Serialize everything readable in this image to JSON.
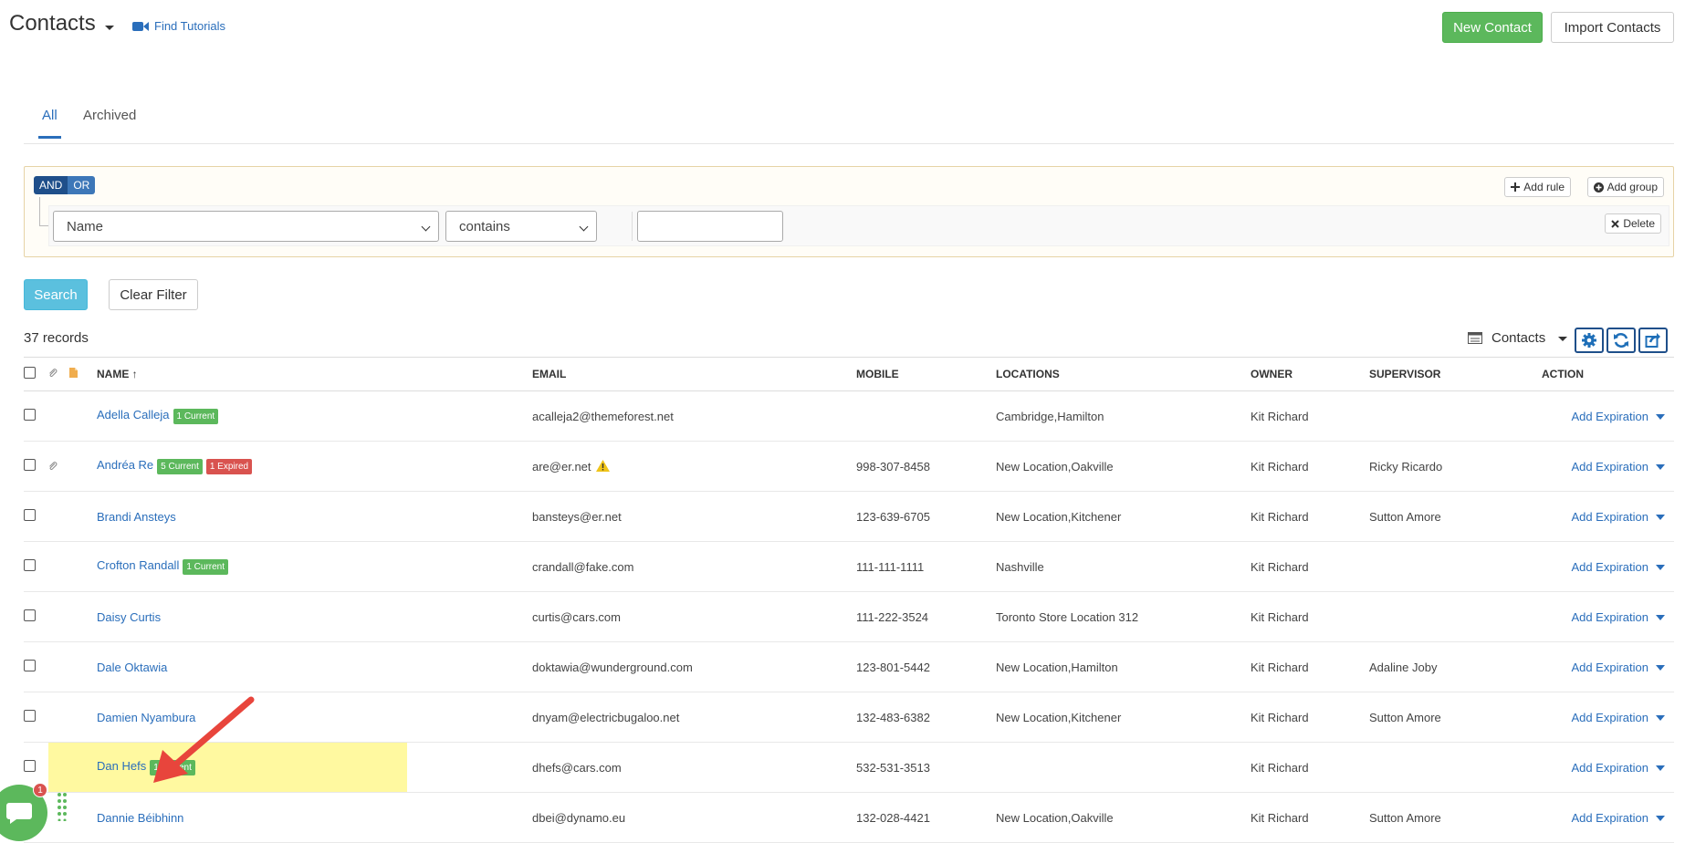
{
  "header": {
    "title": "Contacts",
    "tutorials_label": "Find Tutorials",
    "new_contact_label": "New Contact",
    "import_contacts_label": "Import Contacts"
  },
  "tabs": [
    {
      "label": "All",
      "active": true
    },
    {
      "label": "Archived",
      "active": false
    }
  ],
  "query_builder": {
    "and_label": "AND",
    "or_label": "OR",
    "add_rule_label": "Add rule",
    "add_group_label": "Add group",
    "field_value": "Name",
    "operator_value": "contains",
    "filter_value": "",
    "delete_label": "Delete"
  },
  "actions": {
    "search_label": "Search",
    "clear_filter_label": "Clear Filter"
  },
  "toolbar": {
    "records_label": "37 records",
    "view_label": "Contacts"
  },
  "table": {
    "columns": {
      "name": "NAME ↑",
      "email": "EMAIL",
      "mobile": "MOBILE",
      "locations": "LOCATIONS",
      "owner": "OWNER",
      "supervisor": "SUPERVISOR",
      "action": "ACTION"
    },
    "action_label": "Add Expiration",
    "rows": [
      {
        "name": "Adella Calleja",
        "badge1": "1 Current",
        "email": "acalleja2@themeforest.net",
        "mobile": "",
        "locations": "Cambridge,Hamilton",
        "owner": "Kit Richard",
        "supervisor": ""
      },
      {
        "name": "Andréa Re",
        "badge1": "5 Current",
        "badge2": "1 Expired",
        "email": "are@er.net",
        "mobile": "998-307-8458",
        "locations": "New Location,Oakville",
        "owner": "Kit Richard",
        "supervisor": "Ricky Ricardo"
      },
      {
        "name": "Brandi Ansteys",
        "email": "bansteys@er.net",
        "mobile": "123-639-6705",
        "locations": "New Location,Kitchener",
        "owner": "Kit Richard",
        "supervisor": "Sutton Amore"
      },
      {
        "name": "Crofton Randall",
        "badge1": "1 Current",
        "email": "crandall@fake.com",
        "mobile": "111-111-1111",
        "locations": "Nashville",
        "owner": "Kit Richard",
        "supervisor": ""
      },
      {
        "name": "Daisy Curtis",
        "email": "curtis@cars.com",
        "mobile": "111-222-3524",
        "locations": "Toronto Store Location 312",
        "owner": "Kit Richard",
        "supervisor": ""
      },
      {
        "name": "Dale Oktawia",
        "email": "doktawia@wunderground.com",
        "mobile": "123-801-5442",
        "locations": "New Location,Hamilton",
        "owner": "Kit Richard",
        "supervisor": "Adaline Joby"
      },
      {
        "name": "Damien Nyambura",
        "email": "dnyam@electricbugaloo.net",
        "mobile": "132-483-6382",
        "locations": "New Location,Kitchener",
        "owner": "Kit Richard",
        "supervisor": "Sutton Amore"
      },
      {
        "name": "Dan Hefs",
        "badge1": "1 Current",
        "email": "dhefs@cars.com",
        "mobile": "532-531-3513",
        "locations": "",
        "owner": "Kit Richard",
        "supervisor": ""
      },
      {
        "name": "Dannie Béibhinn",
        "email": "dbei@dynamo.eu",
        "mobile": "132-028-4421",
        "locations": "New Location,Oakville",
        "owner": "Kit Richard",
        "supervisor": "Sutton Amore"
      }
    ]
  },
  "chat": {
    "badge_count": "1"
  },
  "colors": {
    "primary_link": "#2a6ebb",
    "success": "#5cb85c",
    "danger": "#d9534f",
    "info": "#5bc0de",
    "highlight": "#fff9a0",
    "annotation_arrow": "#e8453c"
  }
}
